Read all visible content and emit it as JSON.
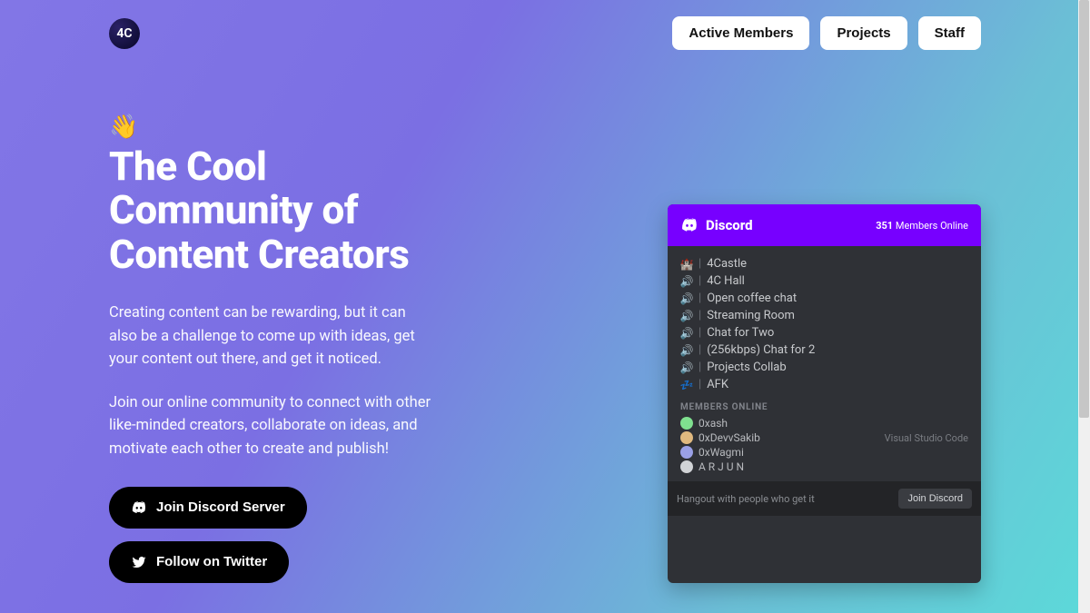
{
  "brand": {
    "logo_text": "4C"
  },
  "nav": {
    "items": [
      "Active Members",
      "Projects",
      "Staff"
    ]
  },
  "hero": {
    "wave": "👋",
    "title": "The Cool Community of Content Creators",
    "para1": "Creating content can be rewarding, but it can also be a challenge to come up with ideas, get your content out there, and get it noticed.",
    "para2": "Join our online community to connect with other like-minded creators, collaborate on ideas, and motivate each other to create and publish!"
  },
  "cta": {
    "discord": "Join Discord Server",
    "twitter": "Follow on Twitter"
  },
  "discord": {
    "brand": "Discord",
    "online_count": "351",
    "online_label": "Members Online",
    "channels": [
      {
        "icon": "🏰",
        "name": "4Castle"
      },
      {
        "icon": "🔊",
        "name": "4C Hall"
      },
      {
        "icon": "🔊",
        "name": "Open coffee chat"
      },
      {
        "icon": "🔊",
        "name": "Streaming Room"
      },
      {
        "icon": "🔊",
        "name": "Chat for Two"
      },
      {
        "icon": "🔊",
        "name": "(256kbps) Chat for 2"
      },
      {
        "icon": "🔊",
        "name": "Projects Collab"
      },
      {
        "icon": "💤",
        "name": "AFK"
      }
    ],
    "members_header": "MEMBERS ONLINE",
    "members": [
      {
        "name": "0xash",
        "color": "#7fe08f",
        "activity": ""
      },
      {
        "name": "0xDevvSakib",
        "color": "#e0b97f",
        "activity": "Visual Studio Code"
      },
      {
        "name": "0xWagmi",
        "color": "#9aa0e6",
        "activity": ""
      },
      {
        "name": "A R J U N",
        "color": "#d1d3d6",
        "activity": ""
      }
    ],
    "footer_tag": "Hangout with people who get it",
    "join_label": "Join Discord"
  }
}
